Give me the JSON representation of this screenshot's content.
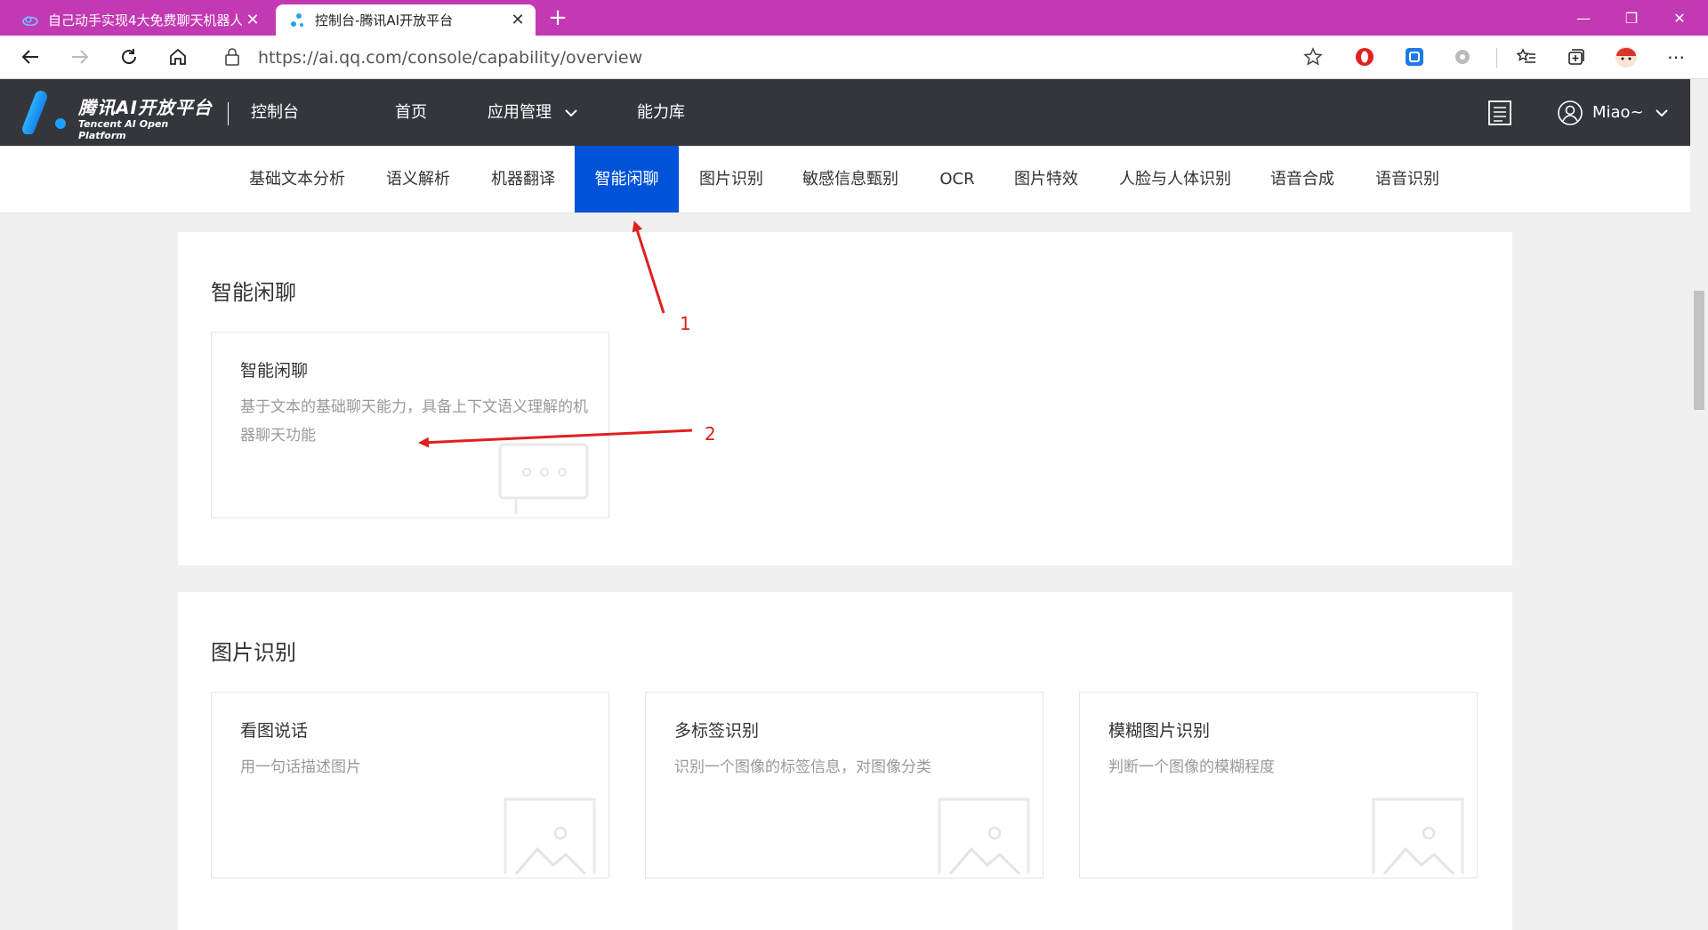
{
  "browser": {
    "tabs": [
      {
        "title": "自己动手实现4大免费聊天机器人",
        "active": false
      },
      {
        "title": "控制台-腾讯AI开放平台",
        "active": true
      }
    ],
    "url": "https://ai.qq.com/console/capability/overview",
    "new_tab": "+",
    "window_controls": [
      "—",
      "❐",
      "✕"
    ]
  },
  "header": {
    "brand": "腾讯AI开放平台",
    "brand_en": "Tencent AI Open Platform",
    "console": "控制台",
    "nav": [
      "首页",
      "应用管理",
      "能力库"
    ],
    "user": "Miao~"
  },
  "subnav": {
    "items": [
      "基础文本分析",
      "语义解析",
      "机器翻译",
      "智能闲聊",
      "图片识别",
      "敏感信息甄别",
      "OCR",
      "图片特效",
      "人脸与人体识别",
      "语音合成",
      "语音识别"
    ],
    "active": "智能闲聊"
  },
  "sections": [
    {
      "title": "智能闲聊",
      "cards": [
        {
          "title": "智能闲聊",
          "desc": "基于文本的基础聊天能力，具备上下文语义理解的机器聊天功能",
          "icon": "chat-icon"
        }
      ]
    },
    {
      "title": "图片识别",
      "cards": [
        {
          "title": "看图说话",
          "desc": "用一句话描述图片",
          "icon": "image-icon"
        },
        {
          "title": "多标签识别",
          "desc": "识别一个图像的标签信息，对图像分类",
          "icon": "image-icon"
        },
        {
          "title": "模糊图片识别",
          "desc": "判断一个图像的模糊程度",
          "icon": "image-icon"
        }
      ]
    }
  ],
  "annotations": {
    "label1": "1",
    "label2": "2",
    "color": "#e02020"
  },
  "colors": {
    "tabbar": "#c239b3",
    "header": "#33363b",
    "active": "#0052d9"
  }
}
